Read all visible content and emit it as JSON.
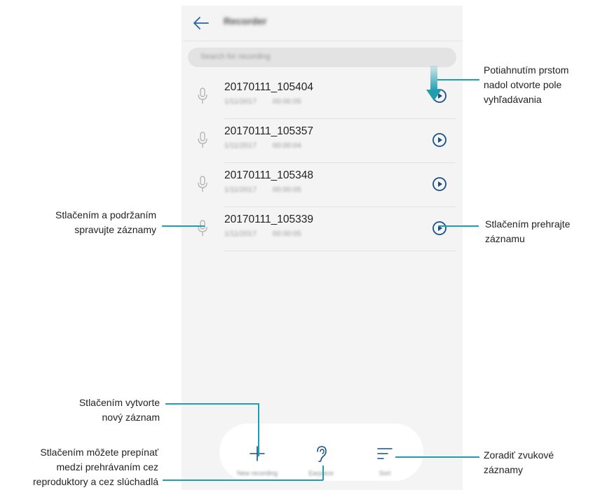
{
  "app": {
    "title": "Recorder",
    "search_placeholder": "Search for recording"
  },
  "recordings": [
    {
      "name": "20170111_105404",
      "date": "1/11/2017",
      "duration": "00:00:05"
    },
    {
      "name": "20170111_105357",
      "date": "1/11/2017",
      "duration": "00:00:04"
    },
    {
      "name": "20170111_105348",
      "date": "1/11/2017",
      "duration": "00:00:05"
    },
    {
      "name": "20170111_105339",
      "date": "1/11/2017",
      "duration": "00:00:05"
    }
  ],
  "bottom_tabs": [
    {
      "label": "New recording",
      "icon": "plus-icon"
    },
    {
      "label": "Earpiece",
      "icon": "ear-icon"
    },
    {
      "label": "Sort",
      "icon": "sort-icon"
    }
  ],
  "callouts": {
    "search_hint": [
      "Potiahnutím prstom",
      "nadol otvorte pole",
      "vyhľadávania"
    ],
    "manage": [
      "Stlačením a podržaním",
      "spravujte záznamy"
    ],
    "play": [
      "Stlačením prehrajte",
      "záznamu"
    ],
    "new": [
      "Stlačením vytvorte",
      "nový záznam"
    ],
    "earpiece": [
      "Stlačením môžete prepínať",
      "medzi prehrávaním cez",
      "reproduktory a cez slúchadlá"
    ],
    "sort": [
      "Zoradiť zvukové",
      "záznamy"
    ]
  },
  "colors": {
    "accent": "#1f9eae",
    "icon_blue": "#1a4f86",
    "background": "#f4f4f4"
  }
}
